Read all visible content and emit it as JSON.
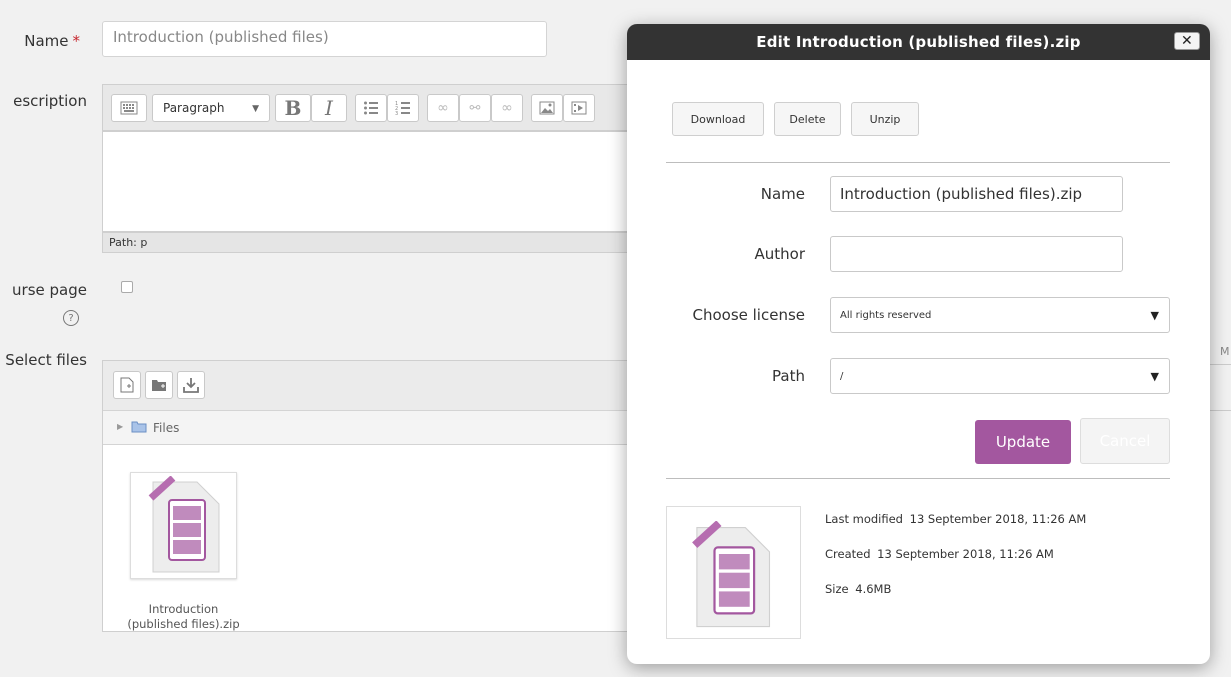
{
  "form": {
    "name_label": "Name",
    "required_mark": "*",
    "name_value": "Introduction (published files)",
    "description_label": "escription",
    "paragraph_select": "Paragraph",
    "path_text": "Path: p",
    "course_page_label": "urse page",
    "select_files_label": "Select files",
    "files_breadcrumb": "Files",
    "file_item_name_line1": "Introduction",
    "file_item_name_line2": "(published files).zip",
    "right_edge_text": "M"
  },
  "dialog": {
    "title": "Edit Introduction (published files).zip",
    "close_symbol": "✕",
    "buttons": {
      "download": "Download",
      "delete": "Delete",
      "unzip": "Unzip",
      "update": "Update",
      "cancel": "Cancel"
    },
    "fields": {
      "name_label": "Name",
      "name_value": "Introduction (published files).zip",
      "author_label": "Author",
      "author_value": "",
      "license_label": "Choose license",
      "license_value": "All rights reserved",
      "path_label": "Path",
      "path_value": "/"
    },
    "meta": {
      "last_modified_label": "Last modified",
      "last_modified_value": "13 September 2018, 11:26 AM",
      "created_label": "Created",
      "created_value": "13 September 2018, 11:26 AM",
      "size_label": "Size",
      "size_value": "4.6MB"
    }
  },
  "colors": {
    "accent_purple": "#a3579f",
    "dialog_header": "#333333",
    "page_bg": "#f1f1f1"
  },
  "icons": [
    "help-icon",
    "file-add-icon",
    "folder-add-icon",
    "download-icon",
    "folder-icon",
    "zip-file-icon",
    "close-icon"
  ]
}
